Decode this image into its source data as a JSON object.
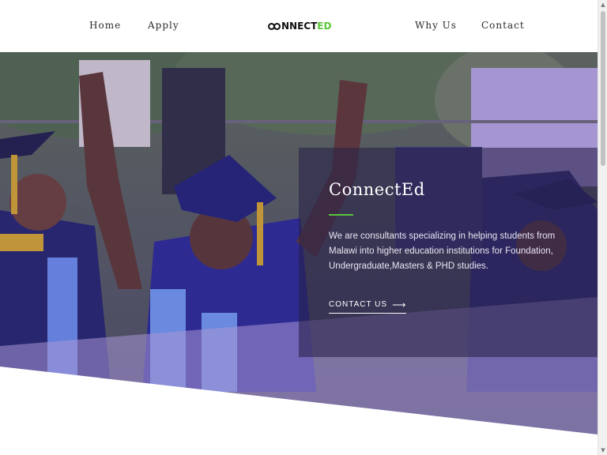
{
  "nav": {
    "left": [
      {
        "label": "Home"
      },
      {
        "label": "Apply"
      }
    ],
    "right": [
      {
        "label": "Why Us"
      },
      {
        "label": "Contact"
      }
    ],
    "logo": {
      "part1": "NNECT",
      "part2": "ED"
    }
  },
  "hero": {
    "title": "ConnectEd",
    "description": "We are consultants specializing in helping students from Malawi into higher education institutions for Foundation, Undergraduate,Masters & PHD studies.",
    "cta_label": "CONTACT US",
    "cta_icon": "arrow-right-icon",
    "photo": "graduates-celebrating-image"
  },
  "colors": {
    "accent": "#5ac639",
    "overlay": "#3b2e7e",
    "gown": "#23258a"
  },
  "scrollbar": {
    "up": "▲",
    "down": "▼"
  }
}
